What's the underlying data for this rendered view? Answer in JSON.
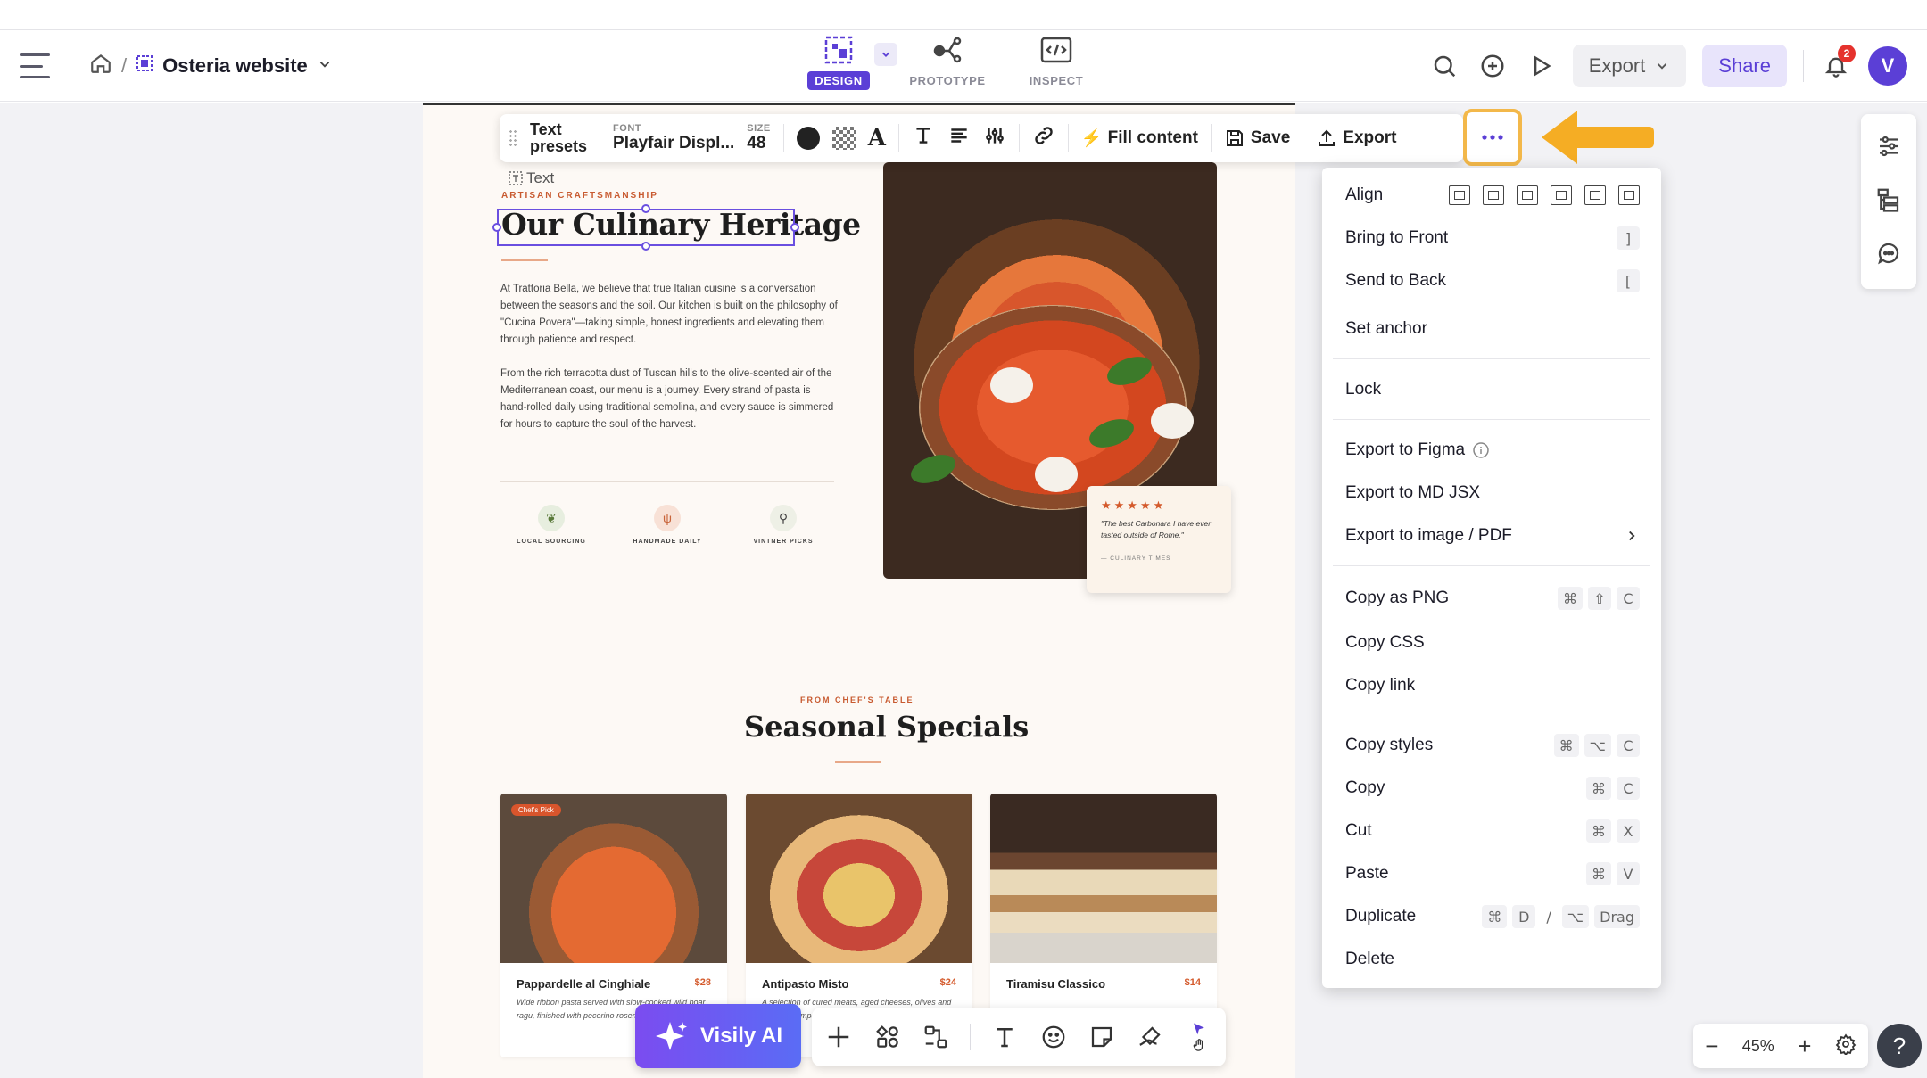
{
  "header": {
    "project_name": "Osteria website",
    "modes": [
      {
        "label": "DESIGN",
        "icon": "design-icon"
      },
      {
        "label": "PROTOTYPE",
        "icon": "prototype-icon"
      },
      {
        "label": "INSPECT",
        "icon": "inspect-icon"
      }
    ],
    "export_label": "Export",
    "share_label": "Share",
    "notification_count": "2",
    "avatar_initial": "V"
  },
  "format_toolbar": {
    "presets_line1": "Text",
    "presets_line2": "presets",
    "font_caption": "FONT",
    "font_value": "Playfair Displ...",
    "size_caption": "SIZE",
    "size_value": "48",
    "fill_content_label": "Fill content",
    "save_label": "Save",
    "export_label": "Export"
  },
  "canvas": {
    "text_tag": "Text",
    "kicker": "ARTISAN CRAFTSMANSHIP",
    "heading": "Our Culinary Heritage",
    "para1": "At Trattoria Bella, we believe that true Italian cuisine is a conversation between the seasons and the soil. Our kitchen is built on the philosophy of \"Cucina Povera\"—taking simple, honest ingredients and elevating them through patience and respect.",
    "para2": "From the rich terracotta dust of Tuscan hills to the olive-scented air of the Mediterranean coast, our menu is a journey. Every strand of pasta is hand-rolled daily using traditional semolina, and every sauce is simmered for hours to capture the soul of the harvest.",
    "features": [
      "LOCAL SOURCING",
      "HANDMADE DAILY",
      "VINTNER PICKS"
    ],
    "quote": {
      "stars": "★★★★★",
      "text": "\"The best Carbonara I have ever tasted outside of Rome.\"",
      "source": "— CULINARY TIMES"
    },
    "specials_kicker": "FROM CHEF'S TABLE",
    "specials_heading": "Seasonal Specials",
    "cards": [
      {
        "name": "Pappardelle al Cinghiale",
        "price": "$28",
        "desc": "Wide ribbon pasta served with slow-cooked wild boar ragu, finished with pecorino rosemary.",
        "badge": "Chef's Pick"
      },
      {
        "name": "Antipasto Misto",
        "price": "$24",
        "desc": "A selection of cured meats, aged cheeses, olives and rustic accompaniments.",
        "badge": ""
      },
      {
        "name": "Tiramisu Classico",
        "price": "$14",
        "desc": "",
        "badge": ""
      }
    ]
  },
  "bottom_toolbar": {
    "ai_label": "Visily AI"
  },
  "context_menu": {
    "align_label": "Align",
    "items": [
      {
        "label": "Bring to Front",
        "keys": [
          "]"
        ]
      },
      {
        "label": "Send to Back",
        "keys": [
          "["
        ]
      },
      {
        "label": "Set anchor",
        "keys": []
      },
      {
        "label": "Lock",
        "keys": []
      },
      {
        "label": "Export to Figma",
        "keys": []
      },
      {
        "label": "Export to MD JSX",
        "keys": []
      },
      {
        "label": "Export to image / PDF",
        "keys": []
      },
      {
        "label": "Copy as PNG",
        "keys": [
          "⌘",
          "⇧",
          "C"
        ]
      },
      {
        "label": "Copy CSS",
        "keys": []
      },
      {
        "label": "Copy link",
        "keys": []
      },
      {
        "label": "Copy styles",
        "keys": [
          "⌘",
          "⌥",
          "C"
        ]
      },
      {
        "label": "Copy",
        "keys": [
          "⌘",
          "C"
        ]
      },
      {
        "label": "Cut",
        "keys": [
          "⌘",
          "X"
        ]
      },
      {
        "label": "Paste",
        "keys": [
          "⌘",
          "V"
        ]
      },
      {
        "label": "Duplicate",
        "keys": [
          "⌘",
          "D",
          "/",
          "⌥",
          "Drag"
        ]
      },
      {
        "label": "Delete",
        "keys": []
      }
    ]
  },
  "zoom": {
    "level": "45%"
  },
  "colors": {
    "accent": "#5b3fd6",
    "highlight": "#f3b84a",
    "brand_orange": "#d45a2c"
  }
}
